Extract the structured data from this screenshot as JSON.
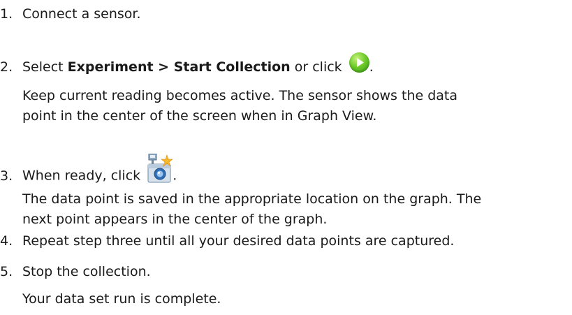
{
  "steps": [
    {
      "num": "1.",
      "text": "Connect a sensor."
    },
    {
      "num": "2.",
      "pre": "Select ",
      "bold": "Experiment > Start Collection",
      "post": " or click ",
      "end": "."
    },
    {
      "num": "3.",
      "pre": "When ready, click ",
      "end": "."
    },
    {
      "num": "4.",
      "text": "Repeat step three until all your desired data points are captured."
    },
    {
      "num": "5.",
      "text": "Stop the collection."
    }
  ],
  "notes": {
    "step2_line1": "Keep current reading becomes active. The sensor shows the data",
    "step2_line2": "point in the center of the screen when in Graph View.",
    "step3_line1": "The data point is saved in the appropriate location on the graph. The",
    "step3_line2": "next point appears in the center of the graph.",
    "step5": "Your data set run is complete."
  },
  "icons": {
    "start_collection": "start-collection-icon",
    "keep_reading": "keep-current-reading-icon",
    "accent_green": "#4db31c"
  }
}
